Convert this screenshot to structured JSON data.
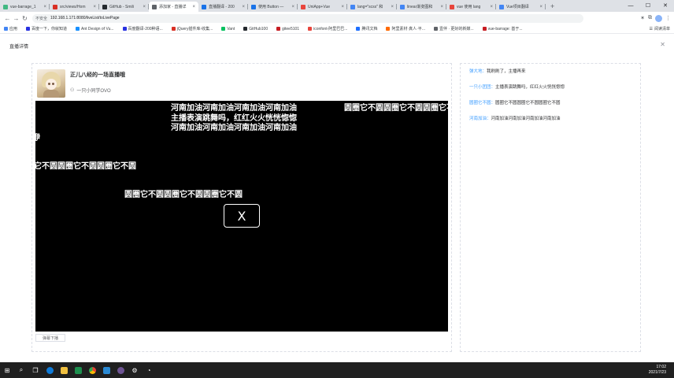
{
  "browser": {
    "tabs": [
      {
        "title": "vue-barrage_1",
        "color": "#42b883"
      },
      {
        "title": "src/views/Hom",
        "color": "#d93025"
      },
      {
        "title": "GitHub - Smili",
        "color": "#24292e"
      },
      {
        "title": "添加家 - 直播详",
        "color": "#5f6368",
        "active": true
      },
      {
        "title": "直播翻译 - 200",
        "color": "#1a73e8"
      },
      {
        "title": "使用 Button —",
        "color": "#1a73e8"
      },
      {
        "title": "UniApp+Vue",
        "color": "#e8453c"
      },
      {
        "title": "lang=\"scss\" 和",
        "color": "#4285f4"
      },
      {
        "title": "linear渐变图和",
        "color": "#4285f4"
      },
      {
        "title": "vue 使用 lang",
        "color": "#e8453c"
      },
      {
        "title": "Vue项目翻译",
        "color": "#4285f4"
      }
    ],
    "new_tab_label": "+",
    "window_controls": [
      "—",
      "☐",
      "✕"
    ],
    "security_label": "不安全",
    "url": "192.168.1.171:8080/liveList/toLivePage",
    "bookmarks": [
      {
        "label": "应用",
        "color": "#4285f4"
      },
      {
        "label": "百度一下，你就知道",
        "color": "#2932e1"
      },
      {
        "label": "Ant Design of Vu...",
        "color": "#1890ff"
      },
      {
        "label": "百度翻译-200种语...",
        "color": "#2932e1"
      },
      {
        "label": "jQuery插件库-收集...",
        "color": "#d93025"
      },
      {
        "label": "Vant",
        "color": "#07c160"
      },
      {
        "label": "GitHub100",
        "color": "#24292e"
      },
      {
        "label": "gitee5101",
        "color": "#c71d23"
      },
      {
        "label": "iconfont-阿里巴巴...",
        "color": "#e8453c"
      },
      {
        "label": "腾讯文档",
        "color": "#1e6fff"
      },
      {
        "label": "阿里素材·真人·平...",
        "color": "#ff6a00"
      },
      {
        "label": "壹伴 · 更好的新媒...",
        "color": "#5f6368"
      },
      {
        "label": "vue-barrage: 基于...",
        "color": "#c71d23"
      }
    ],
    "reading_list": "阅读清单"
  },
  "dialog": {
    "title": "直播详情",
    "close_icon": "✕"
  },
  "room": {
    "title": "正儿八经的一场直播哦",
    "anchor": "一只小同学OVO"
  },
  "player": {
    "danmu": [
      "河南加油河南加油河南加油河南加油",
      "主播表演跳舞吗，红红火火恍恍惚惚",
      "河南加油河南加油河南加油河南加油",
      "圆圈它不圆圆圈它不圆圆圈它不圆",
      "咿",
      "它不圆圆圈它不圆圆圈它不圆",
      "圆圈它不圆圆圈它不圆圆圈它不圆"
    ],
    "close_label": "X"
  },
  "send_button": "弹幕下播",
  "comments": [
    {
      "user": "弹大地：",
      "text": "我刷刷了，主播再来"
    },
    {
      "user": "一只小团团：",
      "text": "主播表演跳舞吗，红红火火恍恍惚惚"
    },
    {
      "user": "圆圈它不圆：",
      "text": "圆圈它不圆圆圈它不圆圆圈它不圆"
    },
    {
      "user": "河南加油：",
      "text": "河南加油河南加油河南加油河南加油"
    }
  ],
  "taskbar": {
    "time": "17:02",
    "date": "2021/7/23"
  }
}
